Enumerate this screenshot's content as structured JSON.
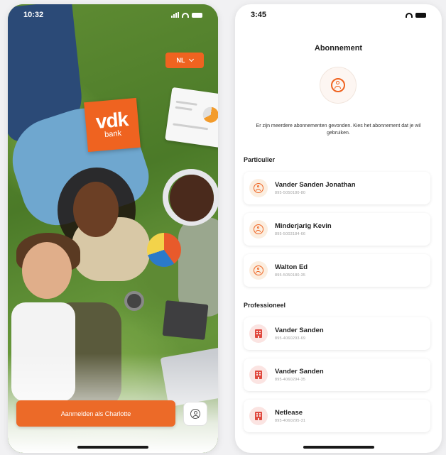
{
  "left_screen": {
    "status_time": "10:32",
    "language_button": "NL",
    "logo": {
      "main": "vdk",
      "sub": "bank"
    },
    "login_button": "Aanmelden als Charlotte",
    "colors": {
      "brand_orange": "#ef6320"
    }
  },
  "right_screen": {
    "status_time": "3:45",
    "title": "Abonnement",
    "intro": "Er zijn meerdere abonnementen gevonden. Kies het abonnement dat je wil gebruiken.",
    "sections": [
      {
        "label": "Particulier",
        "items": [
          {
            "name": "Vander Sanden Jonathan",
            "number": "895-5050180-80",
            "icon": "person-icon"
          },
          {
            "name": "Minderjarig Kevin",
            "number": "895-5003184-66",
            "icon": "person-icon"
          },
          {
            "name": "Walton Ed",
            "number": "895-5050180-35",
            "icon": "person-icon"
          }
        ]
      },
      {
        "label": "Professioneel",
        "items": [
          {
            "name": "Vander Sanden",
            "number": "895-4060293-69",
            "icon": "building-icon"
          },
          {
            "name": "Vander Sanden",
            "number": "895-4060294-35",
            "icon": "building-icon"
          },
          {
            "name": "Netlease",
            "number": "895-4060295-31",
            "icon": "building-icon"
          }
        ]
      }
    ]
  }
}
